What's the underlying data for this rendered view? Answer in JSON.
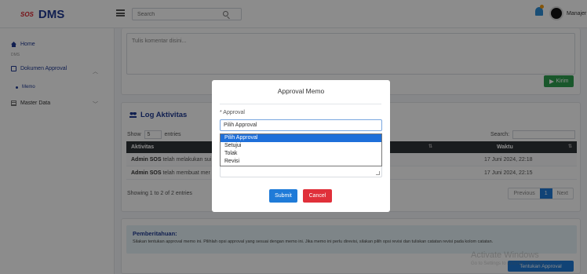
{
  "header": {
    "logo_text": "SOS",
    "brand": "DMS",
    "search_placeholder": "Search",
    "user_name": "Manajer"
  },
  "sidebar": {
    "items": [
      {
        "label": "Home",
        "icon": "home-icon"
      },
      {
        "label": "DMS",
        "icon": ""
      },
      {
        "label": "Dokumen Approval",
        "icon": "document-icon"
      },
      {
        "label": "Memo",
        "icon": "dot-icon"
      },
      {
        "label": "Master Data",
        "icon": "grid-icon"
      }
    ]
  },
  "comment": {
    "placeholder": "Tulis komentar disini...",
    "send_label": "Kirim"
  },
  "log": {
    "title": "Log Aktivitas",
    "show_label": "Show",
    "entries_value": "5",
    "entries_label": "entries",
    "search_label": "Search:",
    "columns": [
      "Aktivitas",
      "Waktu"
    ],
    "rows": [
      {
        "actor": "Admin SOS",
        "text": "telah melakukan sui",
        "time": "17 Juni 2024, 22:18"
      },
      {
        "actor": "Admin SOS",
        "text": "telah membuat mer",
        "time": "17 Juni 2024, 22:15"
      }
    ],
    "showing": "Showing 1 to 2 of 2 entries",
    "pager": {
      "previous": "Previous",
      "page": "1",
      "next": "Next"
    }
  },
  "notice": {
    "title": "Pemberitahuan:",
    "text": "Silakan tentukan approval memo ini. Pilihlah opsi approval yang sesuai dengan memo ini. Jika memo ini perlu direvisi, silakan pilih opsi revisi dan tuliskan catatan revisi pada kolom catatan.",
    "button_label": "Tentukan Approval"
  },
  "watermark": {
    "line1": "Activate Windows",
    "line2": "Go to Settings to activate Windows."
  },
  "modal": {
    "title": "Approval Memo",
    "approval_label": "* Approval",
    "selected": "Pilih Approval",
    "options": [
      "Pilih Approval",
      "Setujui",
      "Tolak",
      "Revisi"
    ],
    "submit_label": "Submit",
    "cancel_label": "Cancel"
  },
  "colors": {
    "brand": "#1f3a93",
    "primary": "#1f7bd8",
    "success": "#2e9e4f",
    "danger": "#e0303a"
  }
}
